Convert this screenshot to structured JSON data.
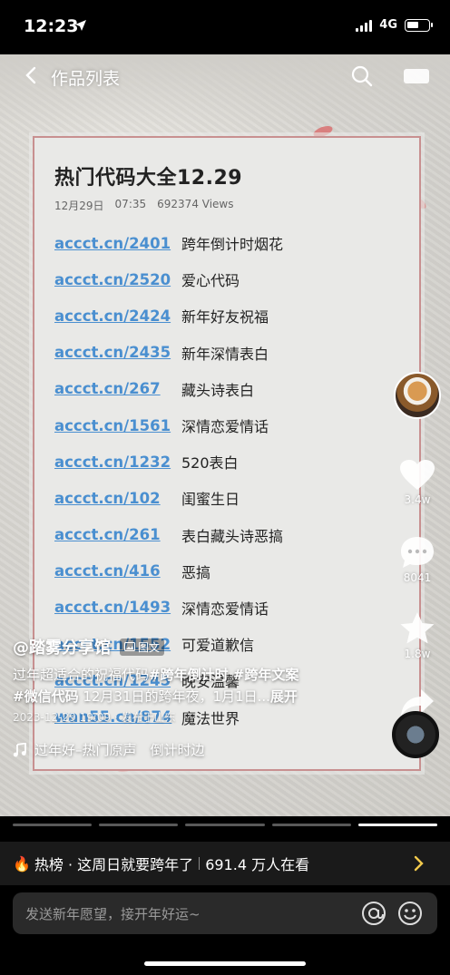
{
  "status": {
    "time": "12:23",
    "network": "4G"
  },
  "nav": {
    "title": "作品列表"
  },
  "card": {
    "title": "热门代码大全12.29",
    "date": "12月29日",
    "time": "07:35",
    "views": "692374 Views",
    "rows": [
      {
        "link": "accct.cn/2401",
        "desc": "跨年倒计时烟花"
      },
      {
        "link": "accct.cn/2520",
        "desc": "爱心代码"
      },
      {
        "link": "accct.cn/2424",
        "desc": "新年好友祝福"
      },
      {
        "link": "accct.cn/2435",
        "desc": "新年深情表白"
      },
      {
        "link": "accct.cn/267",
        "desc": "藏头诗表白"
      },
      {
        "link": "accct.cn/1561",
        "desc": "深情恋爱情话"
      },
      {
        "link": "accct.cn/1232",
        "desc": "520表白"
      },
      {
        "link": "accct.cn/102",
        "desc": "闺蜜生日"
      },
      {
        "link": "accct.cn/261",
        "desc": "表白藏头诗恶搞"
      },
      {
        "link": "accct.cn/416",
        "desc": "恶搞"
      },
      {
        "link": "accct.cn/1493",
        "desc": "深情恋爱情话"
      },
      {
        "link": "accct.cn/1552",
        "desc": "可爱道歉信"
      },
      {
        "link": "accct.cn/1245",
        "desc": "晚安温馨"
      },
      {
        "link": "wan55.cn/874",
        "desc": "魔法世界"
      }
    ]
  },
  "rail": {
    "likes": "3.4w",
    "comments": "8041",
    "favorites": "1.8w",
    "share_label": "分享"
  },
  "caption": {
    "author": "@踏雾分享馆",
    "badge": "图文",
    "line1_plain": "过年超适合的祝福代码",
    "line1_tags": "#跨年倒计时 #跨年文案",
    "line2_tag": "#微信代码",
    "line2_plain": " 12月31日的跨年夜，1月1日...",
    "expand": "展开",
    "posted": "2023-12-29 19:09 · 发布于山东"
  },
  "music": {
    "title": "过年好–热门原声　倒计时边"
  },
  "hot": {
    "icon": "fire-icon",
    "label": "热榜 · 这周日就要跨年了",
    "count": "691.4 万人在看"
  },
  "comment": {
    "placeholder": "发送新年愿望，接开年好运~"
  },
  "progress": {
    "segments": 5,
    "active": 5
  }
}
